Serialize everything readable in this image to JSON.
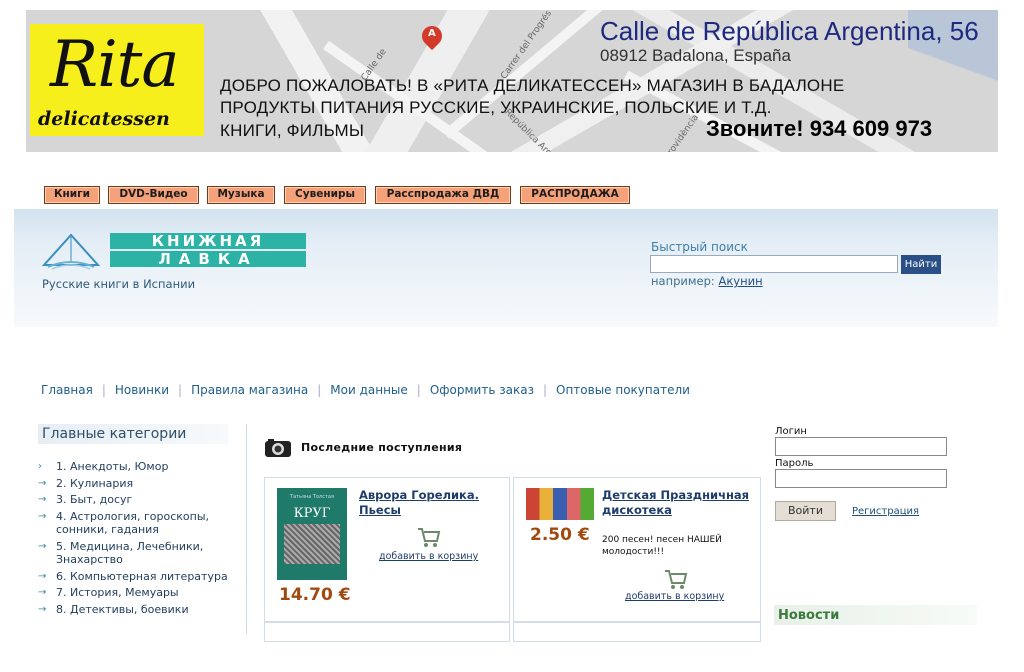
{
  "banner": {
    "logo_main": "Rita",
    "logo_sub": "delicatessen",
    "pin_letter": "A",
    "street_labels": [
      "Carrer del Progrés",
      "República Arg..",
      "Calle de",
      "Providència"
    ],
    "address_line1": "Calle de República Argentina, 56",
    "address_line2": "08912 Badalona, España",
    "welcome_lines": [
      "ДОБРО ПОЖАЛОВАТЬ! В «РИТА ДЕЛИКАТЕССЕН» МАГАЗИН В БАДАЛОНЕ",
      "ПРОДУКТЫ ПИТАНИЯ  РУССКИЕ, УКРАИНСКИЕ, ПОЛЬСКИЕ И Т.Д.",
      "КНИГИ, ФИЛЬМЫ"
    ],
    "phone": "Звоните! 934 609 973",
    "colors": {
      "logo_bg": "#f6ef1c",
      "address": "#1d2a80"
    }
  },
  "tabs": [
    "Книги",
    "DVD-Видео",
    "Музыка",
    "Сувениры",
    "Расспродажа ДВД",
    "РАСПРОДАЖА"
  ],
  "header": {
    "logo_line1": "КНИЖНАЯ",
    "logo_line2": "ЛАВКА",
    "subtitle": "Русские книги в Испании",
    "quick_search_label": "Быстрый поиск",
    "search_value": "",
    "search_button": "Найти",
    "example_prefix": "например: ",
    "example_link": "Акунин",
    "colors": {
      "logo": "#2db3a5",
      "search_button": "#2a4f86"
    }
  },
  "nav": [
    "Главная",
    "Новинки",
    "Правила магазина",
    "Мои данные",
    "Оформить заказ",
    "Оптовые покупатели"
  ],
  "categories": {
    "title": "Главные категории",
    "items": [
      "1. Анекдоты, Юмор",
      "2. Кулинария",
      "3. Быт, досуг",
      "4. Астрология, гороскопы, сонники, гадания",
      "5. Медицина, Лечебники, Знахарство",
      "6. Компьютерная литература",
      "7. История, Мемуары",
      "8. Детективы, боевики"
    ]
  },
  "latest": {
    "title": "Последние поступления",
    "products": [
      {
        "cover_author": "Татьяна Толстая",
        "cover_title": "КРУГ",
        "name": "Аврора Горелика. Пьесы",
        "price": "14.70 €",
        "cart_link": "добавить в корзину"
      },
      {
        "name": "Детская Праздничная дискотека",
        "price": "2.50 €",
        "description": "200 песен! песен НАШЕЙ молодости!!!",
        "cart_link": "добавить в корзину"
      }
    ]
  },
  "login": {
    "login_label": "Логин",
    "login_value": "",
    "password_label": "Пароль",
    "password_value": "",
    "submit": "Войти",
    "register": "Регистрация"
  },
  "news": {
    "title": "Новости"
  }
}
